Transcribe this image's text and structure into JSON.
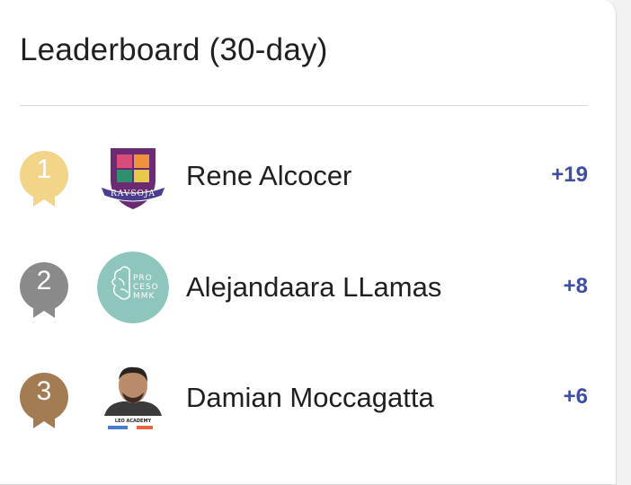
{
  "leaderboard": {
    "title": "Leaderboard (30-day)",
    "entries": [
      {
        "rank": "1",
        "name": "Rene Alcocer",
        "points": "+19",
        "badge_color": "#f3d58a",
        "avatar": {
          "type": "crest-logo",
          "text": "RAVSOJA"
        }
      },
      {
        "rank": "2",
        "name": "Alejandaara LLamas",
        "points": "+8",
        "badge_color": "#8a8a8a",
        "avatar": {
          "type": "circle-logo",
          "text_lines": [
            "PRO",
            "CESO",
            "MMK"
          ],
          "color": "#8ec5bd"
        }
      },
      {
        "rank": "3",
        "name": "Damian Moccagatta",
        "points": "+6",
        "badge_color": "#a37b52",
        "avatar": {
          "type": "photo",
          "caption": "LEO ACADEMY"
        }
      }
    ]
  }
}
